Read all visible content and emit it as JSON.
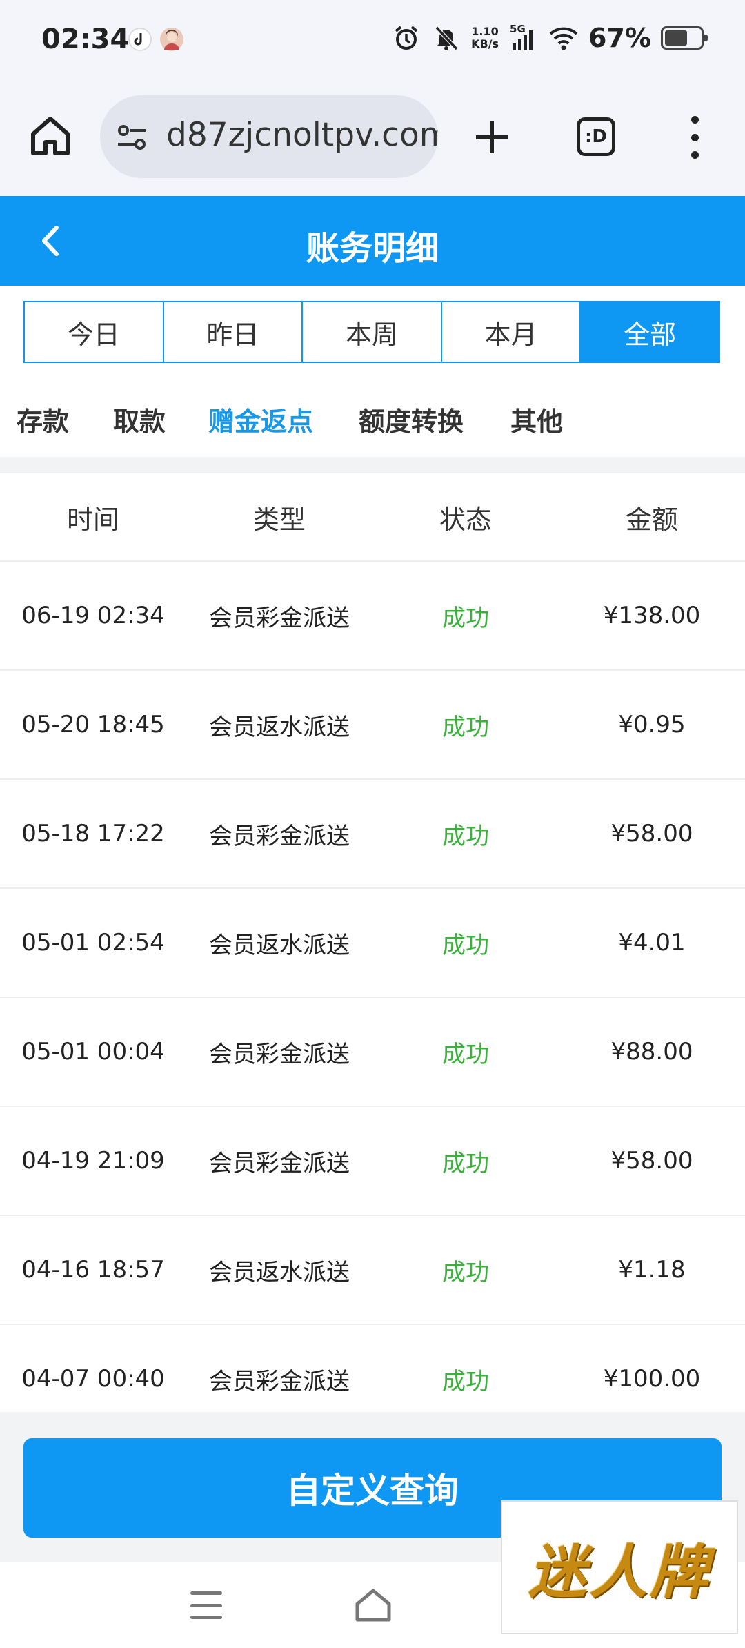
{
  "status_bar": {
    "time": "02:34",
    "net_speed_value": "1.10",
    "net_speed_unit": "KB/s",
    "network": "5G",
    "battery": "67%",
    "battery_level": 0.67
  },
  "browser": {
    "url": "d87zjcnoltpv.com",
    "tabs_label": ":D"
  },
  "header": {
    "title": "账务明细"
  },
  "date_filter": {
    "options": [
      "今日",
      "昨日",
      "本周",
      "本月",
      "全部"
    ],
    "active_index": 4
  },
  "category_tabs": {
    "items": [
      "存款",
      "取款",
      "赠金返点",
      "额度转换",
      "其他"
    ],
    "active_index": 2
  },
  "table": {
    "headers": [
      "时间",
      "类型",
      "状态",
      "金额"
    ],
    "rows": [
      {
        "time": "06-19 02:34",
        "type": "会员彩金派送",
        "status": "成功",
        "amount": "¥138.00"
      },
      {
        "time": "05-20 18:45",
        "type": "会员返水派送",
        "status": "成功",
        "amount": "¥0.95"
      },
      {
        "time": "05-18 17:22",
        "type": "会员彩金派送",
        "status": "成功",
        "amount": "¥58.00"
      },
      {
        "time": "05-01 02:54",
        "type": "会员返水派送",
        "status": "成功",
        "amount": "¥4.01"
      },
      {
        "time": "05-01 00:04",
        "type": "会员彩金派送",
        "status": "成功",
        "amount": "¥88.00"
      },
      {
        "time": "04-19 21:09",
        "type": "会员彩金派送",
        "status": "成功",
        "amount": "¥58.00"
      },
      {
        "time": "04-16 18:57",
        "type": "会员返水派送",
        "status": "成功",
        "amount": "¥1.18"
      },
      {
        "time": "04-07 00:40",
        "type": "会员彩金派送",
        "status": "成功",
        "amount": "¥100.00"
      }
    ]
  },
  "query_button": {
    "label": "自定义查询"
  },
  "watermark": {
    "text": "迷人牌"
  },
  "colors": {
    "primary": "#0f98f3",
    "success": "#3ab13a",
    "active_tab": "#1a98e8"
  }
}
